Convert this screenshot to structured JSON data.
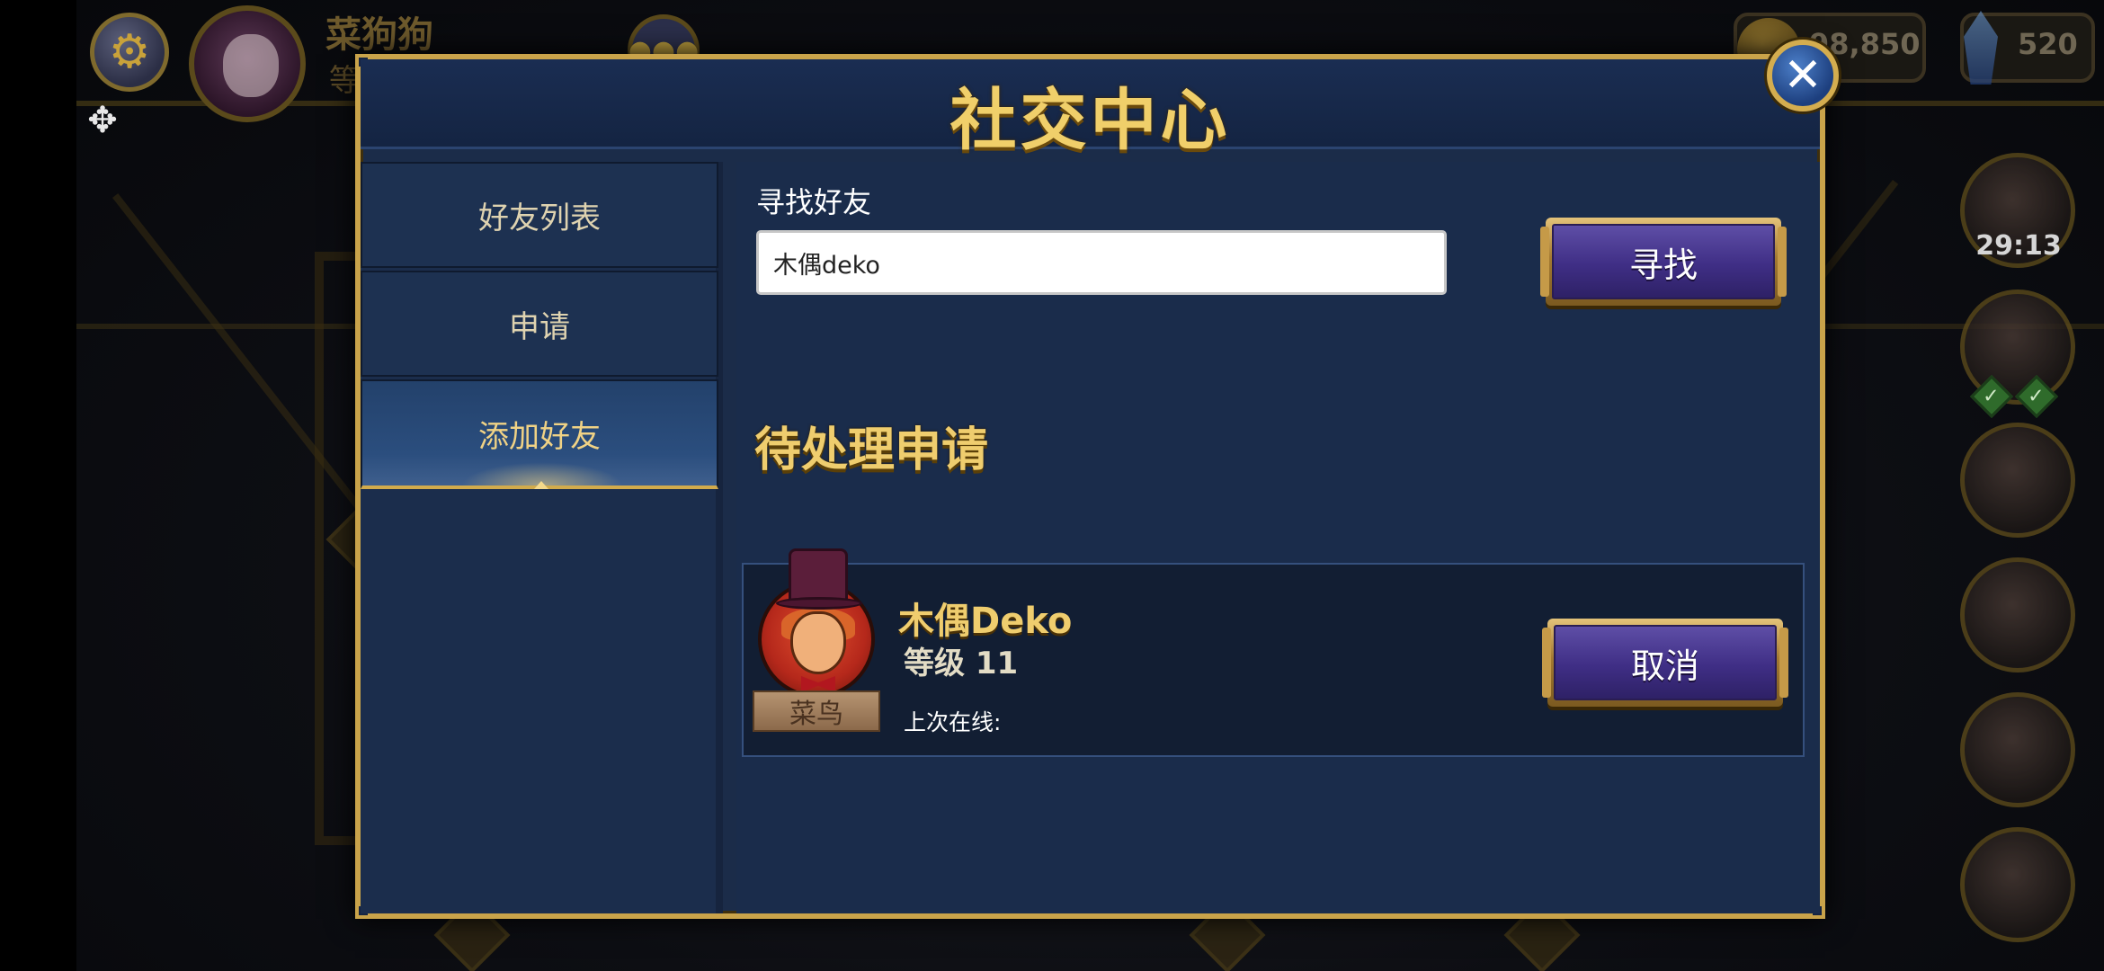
{
  "hud": {
    "player_name": "菜狗狗",
    "player_level": "等",
    "coins": "98,850",
    "gems": "520",
    "timer": "29:13",
    "icons": [
      "gear-icon",
      "chat-icon",
      "coin-icon",
      "gem-icon",
      "puzzle-icon"
    ]
  },
  "modal": {
    "title": "社交中心",
    "close_icon": "✕"
  },
  "sidebar": {
    "tabs": [
      {
        "label": "好友列表",
        "active": false
      },
      {
        "label": "申请",
        "active": false
      },
      {
        "label": "添加好友",
        "active": true
      }
    ]
  },
  "search": {
    "label": "寻找好友",
    "value": "木偶deko",
    "button_label": "寻找"
  },
  "pending": {
    "title": "待处理申请",
    "requests": [
      {
        "name": "木偶Deko",
        "level": "等级 11",
        "rank": "菜鸟",
        "last_online": "上次在线:",
        "cancel_label": "取消"
      }
    ]
  },
  "colors": {
    "accent_gold": "#c9a34a",
    "title_gold": "#f0cf6a",
    "panel_blue": "#1b2c49",
    "button_purple": "#3f2e85"
  }
}
